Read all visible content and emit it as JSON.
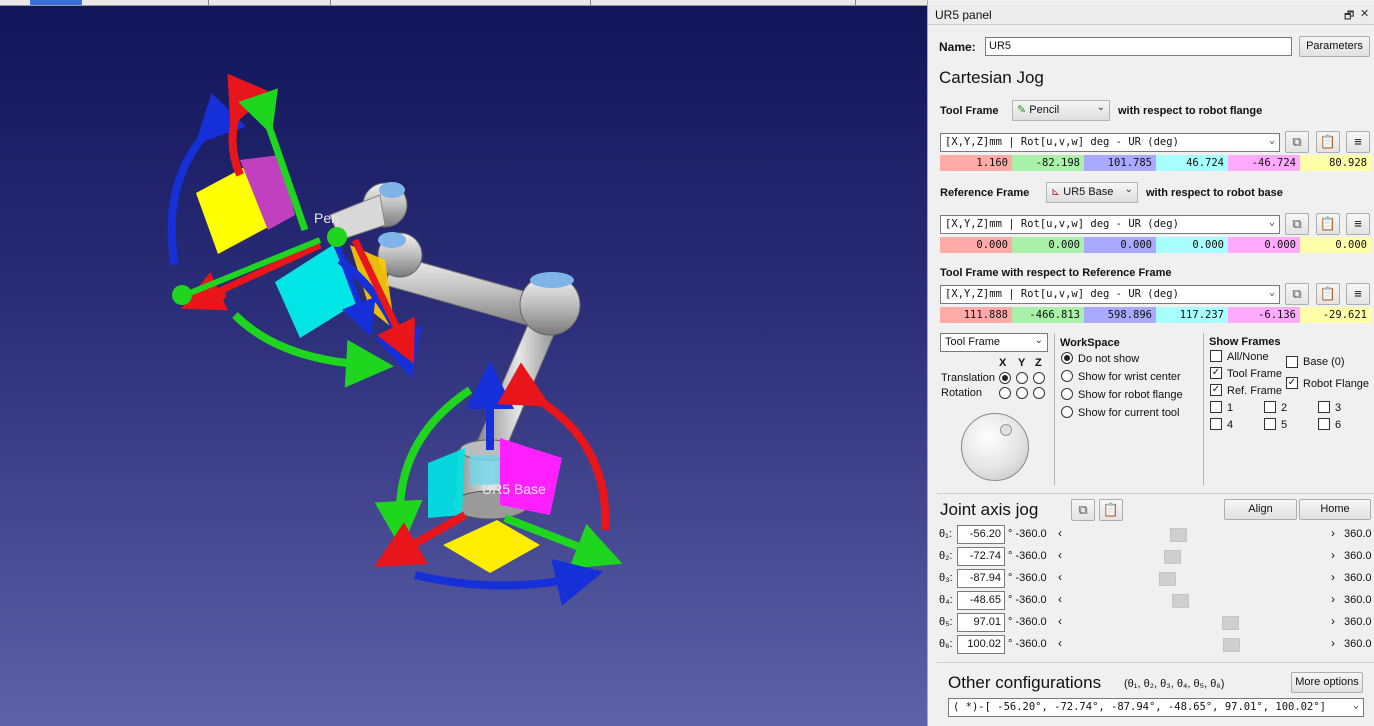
{
  "viewport": {
    "labels": {
      "tool": "Pen",
      "base": "UR5 Base"
    }
  },
  "panel": {
    "title": "UR5 panel",
    "name_label": "Name:",
    "name_value": "UR5",
    "parameters_button": "Parameters",
    "cartesian_jog_title": "Cartesian Jog",
    "tool_frame_label": "Tool Frame",
    "tool_frame_value": "Pencil",
    "tool_frame_suffix": "with respect to robot flange",
    "format_combo": "[X,Y,Z]mm | Rot[u,v,w] deg  - UR (deg)",
    "tool_values": [
      "1.160",
      "-82.198",
      "101.785",
      "46.724",
      "-46.724",
      "80.928"
    ],
    "reference_frame_label": "Reference Frame",
    "reference_frame_value": "UR5 Base",
    "reference_frame_suffix": "with respect to robot base",
    "reference_values": [
      "0.000",
      "0.000",
      "0.000",
      "0.000",
      "0.000",
      "0.000"
    ],
    "tool_wrt_ref_label": "Tool Frame with respect to Reference Frame",
    "tool_wrt_ref_values": [
      "111.888",
      "-466.813",
      "598.896",
      "117.237",
      "-6.136",
      "-29.621"
    ],
    "cell_colors": [
      "#ffa9a9",
      "#a9f0a9",
      "#a9a9ff",
      "#a9ffff",
      "#ffa9ff",
      "#ffffa9"
    ],
    "jog_frame_value": "Tool Frame",
    "axis_headers": [
      "X",
      "Y",
      "Z"
    ],
    "translation_label": "Translation",
    "rotation_label": "Rotation",
    "workspace": {
      "title": "WorkSpace",
      "options": [
        "Do not show",
        "Show for wrist center",
        "Show for robot flange",
        "Show for current tool"
      ],
      "selected": 0
    },
    "show_frames": {
      "title": "Show Frames",
      "all_none": "All/None",
      "base": "Base (0)",
      "tool_frame": "Tool Frame",
      "ref_frame": "Ref. Frame",
      "robot_flange": "Robot Flange",
      "numbers": [
        "1",
        "2",
        "3",
        "4",
        "5",
        "6"
      ]
    },
    "joint_jog_title": "Joint axis jog",
    "align_button": "Align",
    "home_button": "Home",
    "joints": [
      {
        "label": "θ₁:",
        "value": "-56.20",
        "min": "° -360.0",
        "max": "360.0",
        "fraction": 0.422
      },
      {
        "label": "θ₂:",
        "value": "-72.74",
        "min": "° -360.0",
        "max": "360.0",
        "fraction": 0.399
      },
      {
        "label": "θ₃:",
        "value": "-87.94",
        "min": "° -360.0",
        "max": "360.0",
        "fraction": 0.378
      },
      {
        "label": "θ₄:",
        "value": "-48.65",
        "min": "° -360.0",
        "max": "360.0",
        "fraction": 0.432
      },
      {
        "label": "θ₅:",
        "value": "97.01",
        "min": "° -360.0",
        "max": "360.0",
        "fraction": 0.635
      },
      {
        "label": "θ₆:",
        "value": "100.02",
        "min": "° -360.0",
        "max": "360.0",
        "fraction": 0.639
      }
    ],
    "other_configs_title": "Other configurations",
    "other_configs_sub": "(θ₁, θ₂, θ₃, θ₄, θ₅, θ₆)",
    "more_options_button": "More options",
    "config_value": "( *)-[ -56.20°,  -72.74°,  -87.94°,  -48.65°,   97.01°,  100.02°]"
  }
}
